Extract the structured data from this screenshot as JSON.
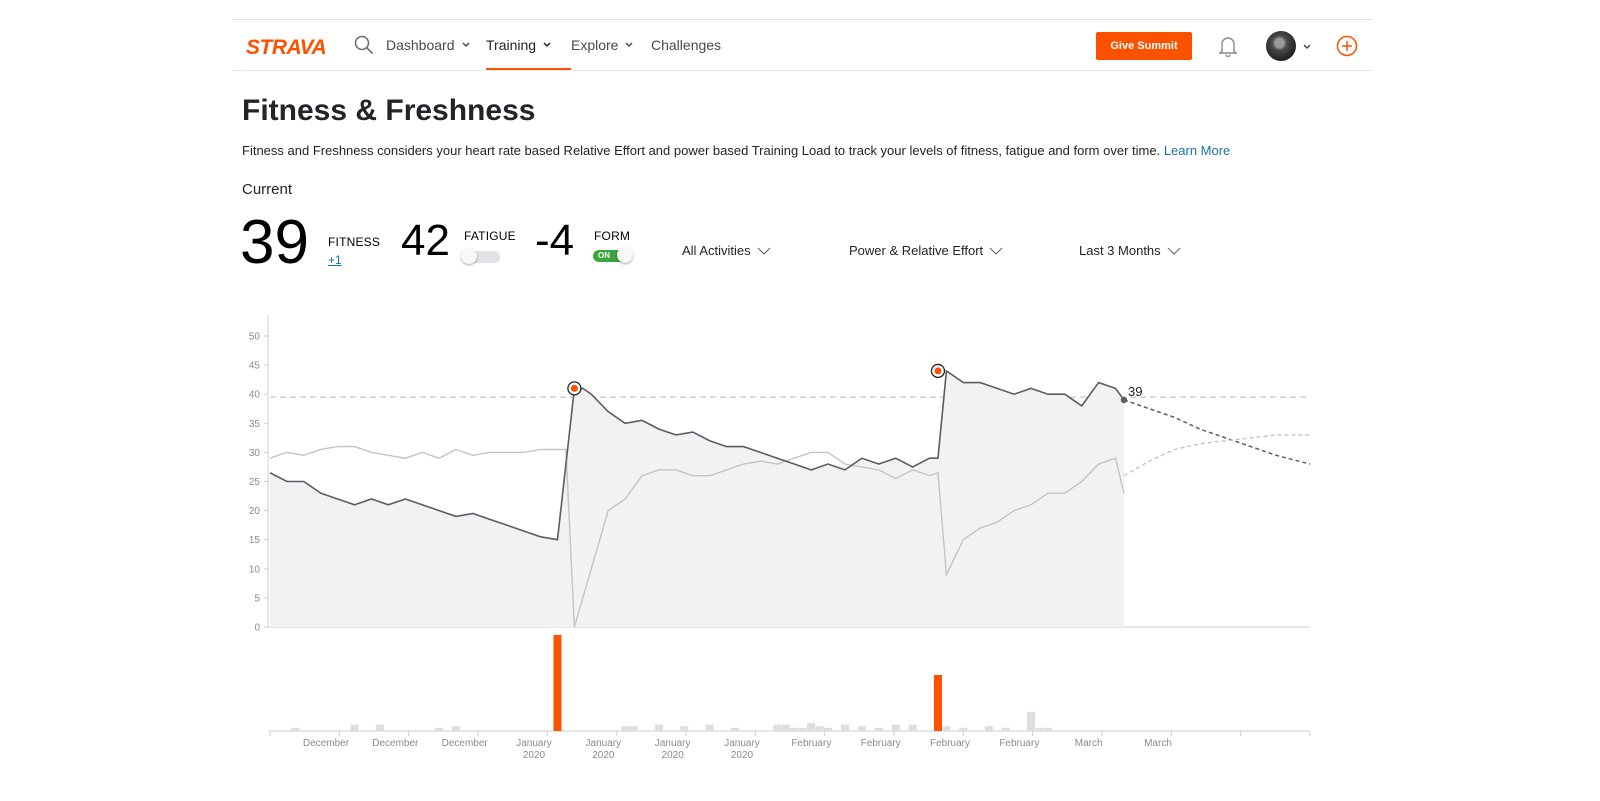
{
  "nav": {
    "logo": "STRAVA",
    "items": [
      {
        "label": "Dashboard",
        "has_menu": true
      },
      {
        "label": "Training",
        "has_menu": true,
        "active": true
      },
      {
        "label": "Explore",
        "has_menu": true
      },
      {
        "label": "Challenges",
        "has_menu": false
      }
    ],
    "summit_button": "Give Summit",
    "accent_color": "#fc5200"
  },
  "page": {
    "title": "Fitness & Freshness",
    "description": "Fitness and Freshness considers your heart rate based Relative Effort and power based Training Load to track your levels of fitness, fatigue and form over time.",
    "learn_more": "Learn More",
    "current_label": "Current"
  },
  "metrics": {
    "fitness": {
      "value": "39",
      "label": "FITNESS",
      "delta": "+1"
    },
    "fatigue": {
      "value": "42",
      "label": "FATIGUE",
      "toggle": false
    },
    "form": {
      "value": "-4",
      "label": "FORM",
      "toggle": true,
      "toggle_text": "ON"
    }
  },
  "filters": {
    "activities": "All Activities",
    "effort": "Power & Relative Effort",
    "range": "Last 3 Months"
  },
  "chart_data": {
    "type": "line",
    "ylim": [
      0,
      50
    ],
    "yticks": [
      "0",
      "5",
      "10",
      "15",
      "20",
      "25",
      "30",
      "35",
      "40",
      "45",
      "50"
    ],
    "current_value_label": "39",
    "series": [
      {
        "x": [
          0,
          2,
          4,
          6,
          8,
          10,
          12,
          14,
          16,
          18,
          20,
          22,
          24,
          26,
          28,
          30,
          32,
          34,
          36,
          37,
          38,
          40,
          42,
          44,
          46,
          48,
          50,
          52,
          54,
          56,
          58,
          60,
          62,
          64,
          66,
          68,
          70,
          72,
          74,
          76,
          78,
          79,
          80,
          82,
          84,
          86,
          88,
          90,
          92,
          94,
          96,
          98,
          100,
          101
        ],
        "values": [
          26.5,
          25,
          25,
          23,
          22,
          21,
          22,
          21,
          22,
          21,
          20,
          19,
          19.5,
          18.5,
          17.5,
          16.5,
          15.5,
          15,
          41,
          41,
          40,
          37,
          35,
          35.5,
          34,
          33,
          33.5,
          32,
          31,
          31,
          30,
          29,
          28,
          27,
          28,
          27,
          29,
          28,
          29,
          27.5,
          29,
          29,
          44,
          42,
          42,
          41,
          40,
          41,
          40,
          40,
          38,
          42,
          41,
          39
        ]
      },
      {
        "x": [
          0,
          2,
          4,
          6,
          8,
          10,
          12,
          14,
          16,
          18,
          20,
          22,
          24,
          26,
          28,
          30,
          32,
          34,
          35,
          36,
          38,
          40,
          42,
          44,
          46,
          48,
          50,
          52,
          54,
          56,
          58,
          60,
          62,
          64,
          66,
          68,
          70,
          72,
          74,
          76,
          78,
          79,
          80,
          82,
          84,
          86,
          88,
          90,
          92,
          94,
          96,
          98,
          100,
          101
        ],
        "values": [
          29,
          30,
          29.5,
          30.5,
          31,
          31,
          30,
          29.5,
          29,
          30,
          29,
          30.5,
          29.5,
          30,
          30,
          30,
          30.5,
          30.5,
          30.5,
          0,
          10,
          20,
          22,
          26,
          27,
          27,
          26,
          26,
          27,
          28,
          28.5,
          28,
          29,
          30,
          30,
          28,
          27.5,
          27,
          25.5,
          27,
          26,
          26.5,
          9,
          15,
          17,
          18,
          20,
          21,
          23,
          23,
          25,
          28,
          29,
          23
        ]
      }
    ],
    "projection": {
      "fitness_x": [
        101,
        104,
        107,
        110,
        113,
        116,
        119,
        123
      ],
      "fitness_values": [
        39,
        37.5,
        36,
        34,
        32.5,
        31,
        29.5,
        28
      ],
      "form_x": [
        101,
        104,
        107,
        110,
        113,
        116,
        119,
        123
      ],
      "form_values": [
        26,
        28.5,
        30.5,
        31.5,
        32,
        32.5,
        33,
        33
      ]
    },
    "peak_markers": [
      {
        "x": 36,
        "value": 41
      },
      {
        "x": 79,
        "value": 44
      }
    ],
    "reference_value": 39.5,
    "bars": {
      "x": [
        3,
        10,
        13,
        20,
        22,
        34,
        42,
        43,
        46,
        49,
        52,
        55,
        60,
        61,
        62,
        63,
        64,
        65,
        66,
        68,
        70,
        72,
        74,
        76,
        79,
        80,
        82,
        85,
        87,
        90,
        91,
        92
      ],
      "values": [
        2,
        4,
        4,
        2,
        3,
        60,
        3,
        3,
        4,
        3,
        4,
        2,
        4,
        4,
        2,
        2,
        5,
        3,
        2,
        4,
        3,
        2,
        4,
        4,
        35,
        3,
        2,
        3,
        2,
        12,
        2,
        2
      ],
      "highlight": [
        34,
        79
      ]
    },
    "x_tick_labels": [
      [
        "December"
      ],
      [
        "December"
      ],
      [
        "December"
      ],
      [
        "January",
        "2020"
      ],
      [
        "January",
        "2020"
      ],
      [
        "January",
        "2020"
      ],
      [
        "January",
        "2020"
      ],
      [
        "February"
      ],
      [
        "February"
      ],
      [
        "February"
      ],
      [
        "February"
      ],
      [
        "March"
      ],
      [
        "March"
      ]
    ]
  }
}
